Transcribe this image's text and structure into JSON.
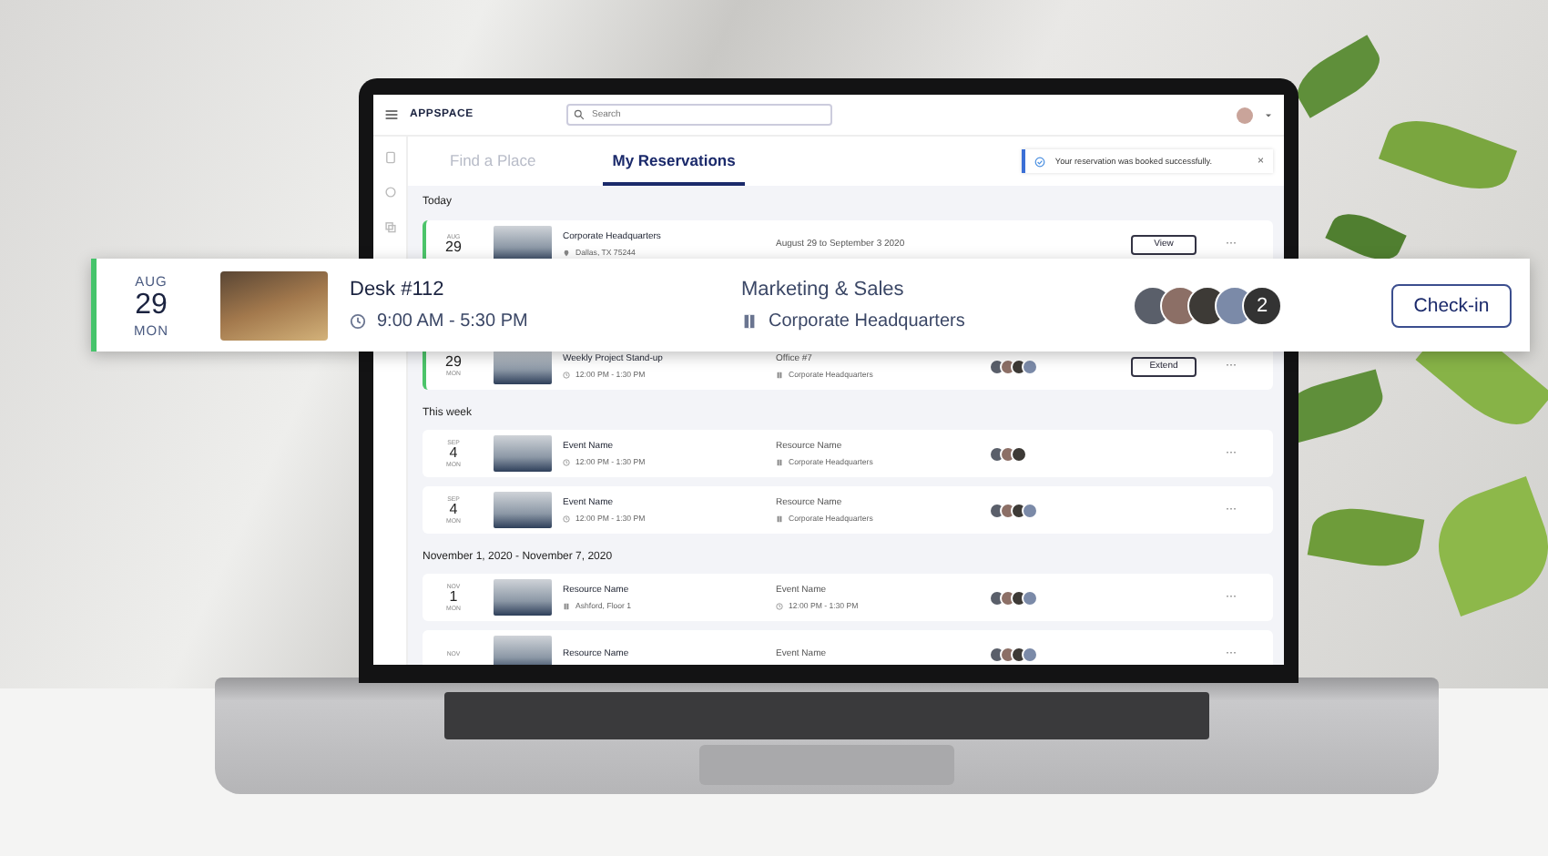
{
  "app": {
    "brand": "APPSPACE",
    "search": {
      "placeholder": "Search"
    }
  },
  "tabs": [
    {
      "label": "Find a Place",
      "selected": false
    },
    {
      "label": "My Reservations",
      "selected": true
    }
  ],
  "toast": {
    "message": "Your reservation was booked successfully.",
    "close": "×"
  },
  "sections": [
    {
      "label": "Today",
      "rows": [
        {
          "accent": true,
          "month": "AUG",
          "day": "29",
          "title": "Corporate Headquarters",
          "detail": {
            "kind": "pin",
            "text": "Dallas, TX 75244"
          },
          "resource": {
            "title": "August 29 to September 3 2020"
          },
          "avatars": [],
          "button": "View",
          "more": "···"
        },
        {
          "accent": true,
          "day": "29",
          "weekday": "MON",
          "title": "Weekly Project Stand-up",
          "detail": {
            "kind": "clock",
            "text": "12:00 PM - 1:30 PM"
          },
          "resource": {
            "title": "Office #7",
            "detail": {
              "kind": "building",
              "text": "Corporate Headquarters"
            }
          },
          "avatars": [
            {
              "kind": "photo"
            },
            {
              "kind": "photo"
            },
            {
              "kind": "photo"
            },
            {
              "kind": "photo"
            }
          ],
          "button": "Extend",
          "more": "···"
        }
      ]
    },
    {
      "label": "This week",
      "rows": [
        {
          "accent": false,
          "month": "SEP",
          "day": "4",
          "weekday": "MON",
          "title": "Event Name",
          "detail": {
            "kind": "clock",
            "text": "12:00 PM - 1:30 PM"
          },
          "resource": {
            "title": "Resource Name",
            "detail": {
              "kind": "building",
              "text": "Corporate Headquarters"
            }
          },
          "avatars": [
            {
              "kind": "photo"
            },
            {
              "kind": "photo"
            },
            {
              "kind": "photo"
            }
          ],
          "more": "···"
        },
        {
          "accent": false,
          "month": "SEP",
          "day": "4",
          "weekday": "MON",
          "title": "Event Name",
          "detail": {
            "kind": "clock",
            "text": "12:00 PM - 1:30 PM"
          },
          "resource": {
            "title": "Resource Name",
            "detail": {
              "kind": "building",
              "text": "Corporate Headquarters"
            }
          },
          "avatars": [
            {
              "kind": "photo"
            },
            {
              "kind": "photo"
            },
            {
              "kind": "photo"
            },
            {
              "kind": "photo"
            }
          ],
          "more": "···"
        }
      ]
    },
    {
      "label": "November 1, 2020 - November 7, 2020",
      "rows": [
        {
          "accent": false,
          "month": "NOV",
          "day": "1",
          "weekday": "MON",
          "title": "Resource Name",
          "detail": {
            "kind": "building",
            "text": "Ashford, Floor 1"
          },
          "resource": {
            "title": "Event Name",
            "detail": {
              "kind": "clock",
              "text": "12:00 PM - 1:30 PM"
            }
          },
          "avatars": [
            {
              "kind": "photo"
            },
            {
              "kind": "photo"
            },
            {
              "kind": "photo"
            },
            {
              "kind": "photo"
            }
          ],
          "more": "···"
        },
        {
          "accent": false,
          "month": "NOV",
          "title": "Resource Name",
          "resource": {
            "title": "Event Name"
          },
          "avatars": [
            {
              "kind": "photo"
            },
            {
              "kind": "photo"
            },
            {
              "kind": "photo"
            },
            {
              "kind": "photo"
            }
          ],
          "more": "···"
        }
      ]
    }
  ],
  "card": {
    "accent": true,
    "month": "AUG",
    "day": "29",
    "weekday": "MON",
    "title": "Desk #112",
    "detail": {
      "kind": "clock",
      "text": "9:00 AM - 5:30 PM"
    },
    "resource": {
      "title": "Marketing & Sales",
      "detail": {
        "kind": "building",
        "text": "Corporate Headquarters"
      }
    },
    "avatars": [
      {
        "kind": "photo"
      },
      {
        "kind": "photo"
      },
      {
        "kind": "photo"
      },
      {
        "kind": "photo"
      },
      {
        "kind": "count",
        "label": "2"
      }
    ],
    "button": "Check-in"
  }
}
